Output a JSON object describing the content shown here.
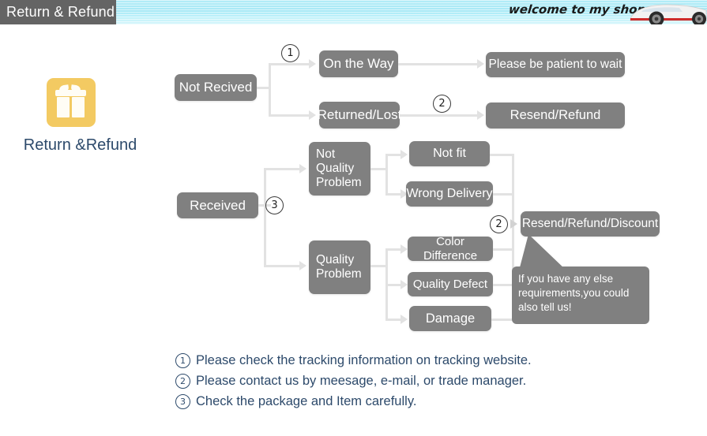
{
  "header": {
    "title": "Return & Refund",
    "welcome": "welcome to my shop",
    "car_icon": "sports-car-graphic"
  },
  "badge": {
    "icon": "gift-box-icon",
    "label": "Return &Refund"
  },
  "flow": {
    "not_received": "Not Recived",
    "on_the_way": "On the Way",
    "returned_lost": "Returned/Lost",
    "please_wait": "Please be patient to wait",
    "resend_refund": "Resend/Refund",
    "received": "Received",
    "not_quality_problem": "Not\nQuality\nProblem",
    "not_quality_problem_l1": "Not",
    "not_quality_problem_l2": "Quality",
    "not_quality_problem_l3": "Problem",
    "not_fit": "Not fit",
    "wrong_delivery": "Wrong Delivery",
    "quality_problem_l1": "Quality",
    "quality_problem_l2": "Problem",
    "color_difference": "Color Difference",
    "quality_defect": "Quality Defect",
    "damage": "Damage",
    "resend_refund_discount": "Resend/Refund/Discount"
  },
  "markers": {
    "one": "①",
    "one_plain": "1",
    "two_plain": "2",
    "three_plain": "3"
  },
  "bubble": {
    "line1": "If you have any else",
    "line2": "requirements,you could",
    "line3": "also tell us!"
  },
  "legend": {
    "items": [
      {
        "num": "1",
        "text": "Please check the tracking information on tracking website."
      },
      {
        "num": "2",
        "text": "Please contact us by meesage, e-mail, or trade manager."
      },
      {
        "num": "3",
        "text": "Check the package and Item carefully."
      }
    ]
  },
  "colors": {
    "node_gray": "#808080",
    "connector": "#e2e2e2",
    "header_cyan": "#a8e9f6",
    "header_title_bg": "#646464",
    "gift_gold": "#f3ca62",
    "legend_blue": "#2d4a6b"
  }
}
